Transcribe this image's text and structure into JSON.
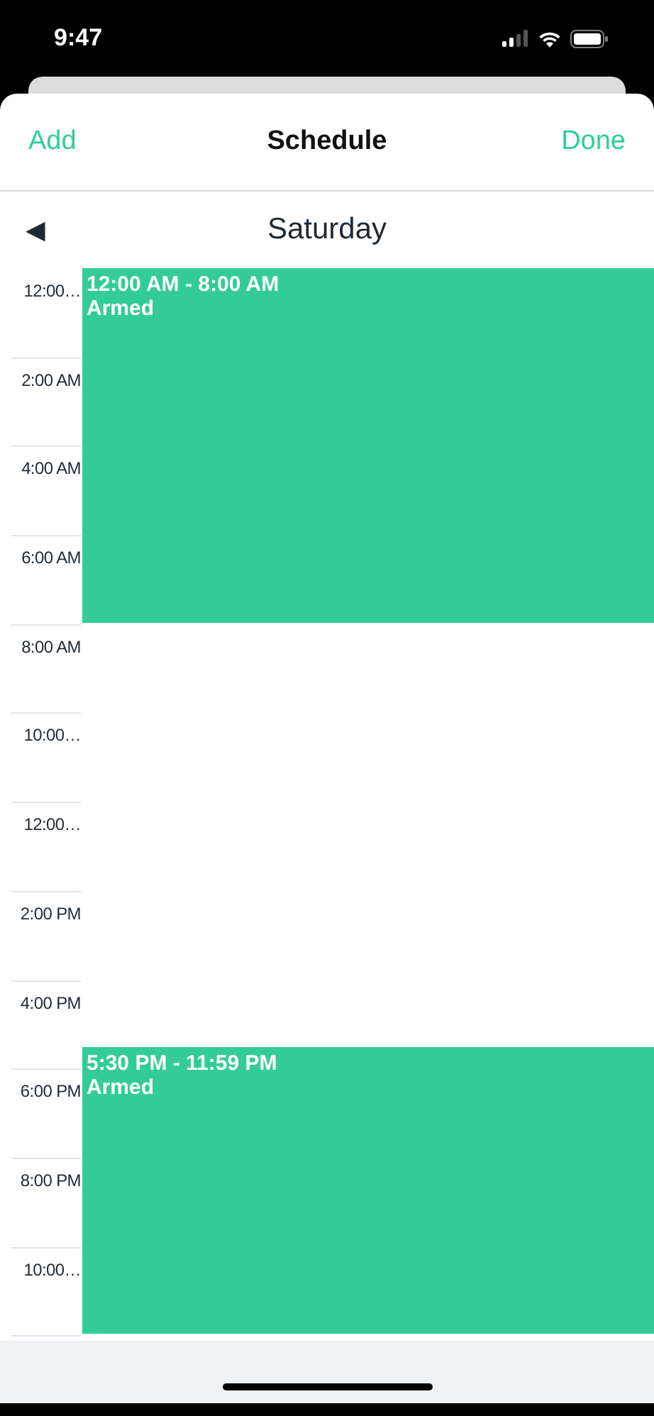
{
  "status_bar": {
    "time": "9:47"
  },
  "nav": {
    "left": "Add",
    "title": "Schedule",
    "right": "Done"
  },
  "day": {
    "back": "◀",
    "title": "Saturday"
  },
  "hours": [
    "12:00…",
    "2:00 AM",
    "4:00 AM",
    "6:00 AM",
    "8:00 AM",
    "10:00…",
    "12:00…",
    "2:00 PM",
    "4:00 PM",
    "6:00 PM",
    "8:00 PM",
    "10:00…"
  ],
  "events": [
    {
      "time": "12:00 AM - 8:00 AM",
      "label": "Armed"
    },
    {
      "time": "5:30 PM - 11:59 PM",
      "label": "Armed"
    }
  ]
}
